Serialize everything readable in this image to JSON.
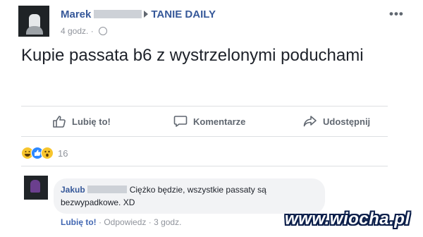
{
  "post": {
    "author": "Marek",
    "group": "TANIE DAILY",
    "time": "4 godz.",
    "more_label": "•••",
    "text": "Kupie passata b6 z wystrzelonymi poduchami"
  },
  "actions": {
    "like": "Lubię to!",
    "comment": "Komentarze",
    "share": "Udostępnij"
  },
  "reactions": {
    "count": "16",
    "icons": [
      "haha-icon",
      "like-icon",
      "wow-icon"
    ]
  },
  "comment": {
    "author": "Jakub",
    "text_line1": "Ciężko będzie, wszystkie passaty są",
    "text_line2": "bezwypadkowe. XD",
    "like": "Lubię to!",
    "reply": "Odpowiedz",
    "time": "3 godz.",
    "separator": "·"
  },
  "watermark": "www.wiocha.pl",
  "colors": {
    "link_blue": "#365899",
    "meta_gray": "#90949c",
    "like_blue": "#4267b2"
  }
}
